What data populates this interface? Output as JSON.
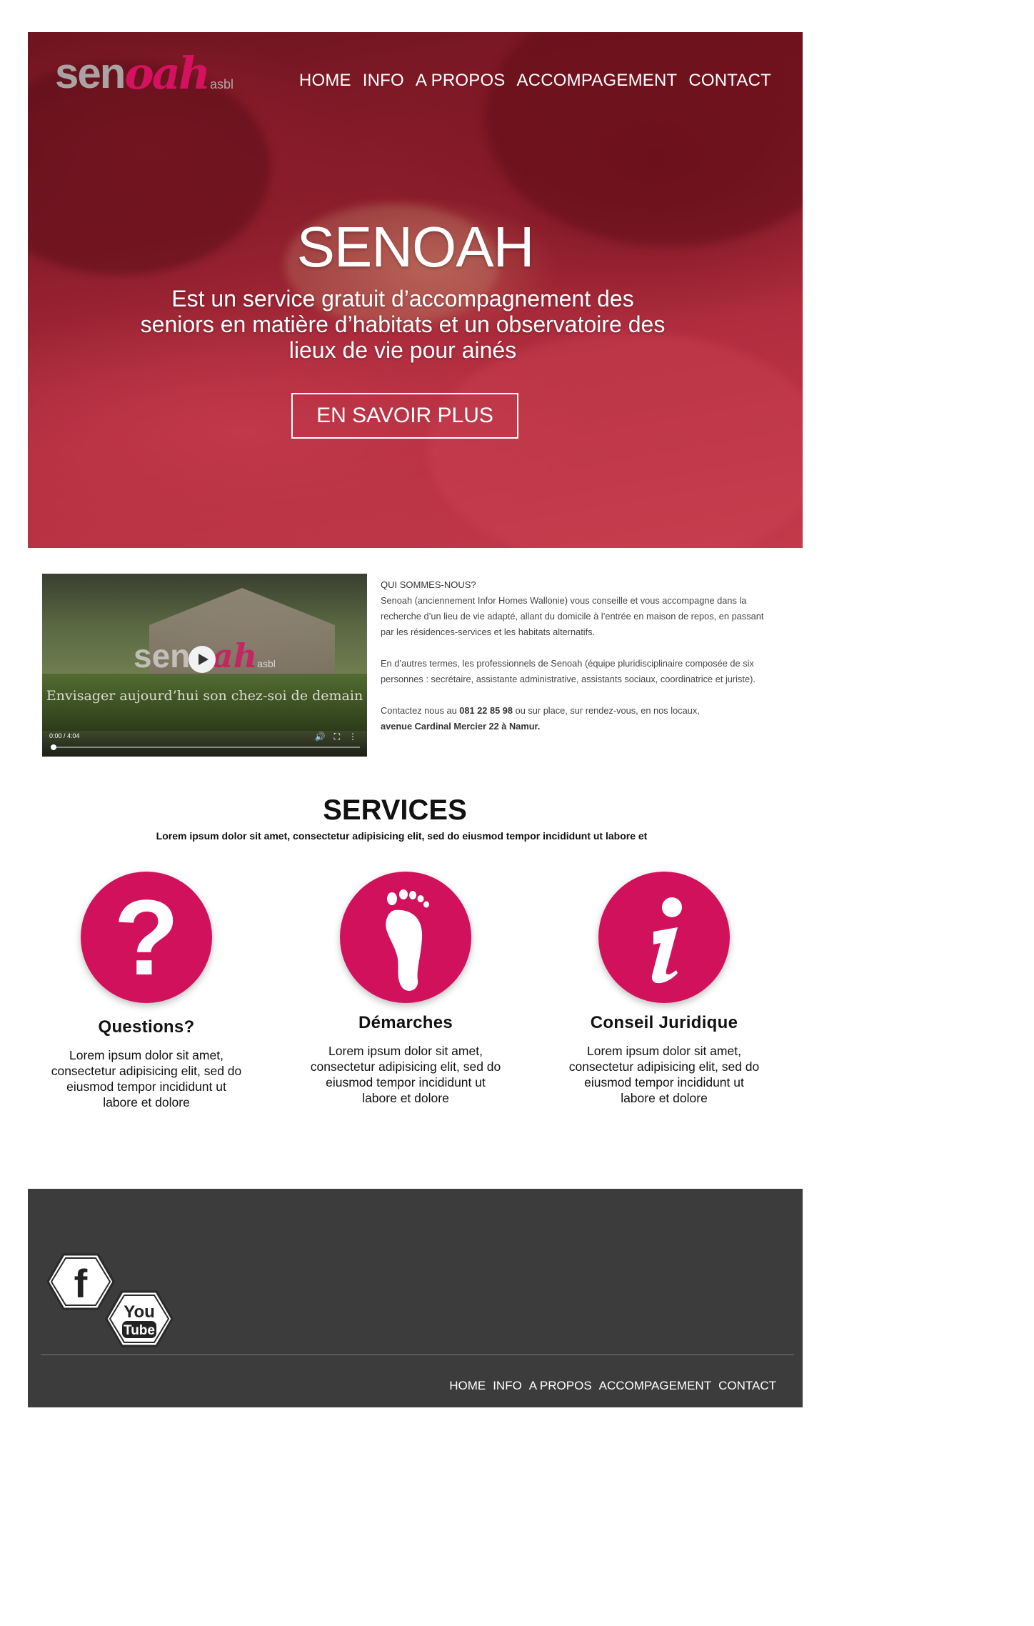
{
  "brand": {
    "logo_main": "sen",
    "logo_accent": "oah",
    "logo_suffix": "asbl"
  },
  "nav": [
    "HOME",
    "INFO",
    "A PROPOS",
    "ACCOMPAGEMENT",
    "CONTACT"
  ],
  "hero": {
    "title": "SENOAH",
    "subtitle": "Est un service gratuit d’accompagnement des seniors en matière d’habitats et un observatoire des lieux de vie pour ainés",
    "button": "EN SAVOIR PLUS"
  },
  "video": {
    "caption": "Envisager aujourd’hui son chez-soi de demain",
    "time": "0:00 / 4:04",
    "progress": 0
  },
  "about": {
    "heading": "QUI SOMMES-NOUS?",
    "p1": "Senoah (anciennement Infor Homes Wallonie) vous conseille et vous accompagne dans la recherche d’un lieu de vie adapté, allant du domicile à l’entrée en maison de repos, en passant par les résidences-services et les habitats alternatifs.",
    "p2": "En d’autres termes, les professionnels de Senoah (équipe pluridisciplinaire composée de six personnes : secrétaire, assistante administrative, assistants sociaux, coordinatrice et juriste).",
    "contact_prefix": "Contactez nous au ",
    "phone": "081 22 85 98",
    "contact_middle": " ou sur place, sur rendez-vous, en nos locaux,",
    "address": "avenue Cardinal Mercier 22 à Namur."
  },
  "services": {
    "title": "SERVICES",
    "subtitle": "Lorem ipsum dolor sit amet, consectetur adipisicing elit, sed do eiusmod tempor incididunt ut labore et",
    "items": [
      {
        "icon": "question-icon",
        "title": "Questions?",
        "text": "Lorem ipsum dolor sit amet, consectetur adipisicing elit, sed do eiusmod tempor incididunt ut labore et dolore"
      },
      {
        "icon": "footprint-icon",
        "title": "Démarches",
        "text": "Lorem ipsum dolor sit amet, consectetur adipisicing elit, sed do eiusmod tempor incididunt ut labore et dolore"
      },
      {
        "icon": "info-icon",
        "title": "Conseil Juridique",
        "text": "Lorem ipsum dolor sit amet, consectetur adipisicing elit, sed do eiusmod tempor incididunt ut labore et dolore"
      }
    ]
  },
  "footer": {
    "social": [
      "facebook-icon",
      "youtube-icon"
    ],
    "youtube_text_1": "You",
    "youtube_text_2": "Tube",
    "facebook_letter": "f",
    "nav": [
      "HOME",
      "INFO",
      "A PROPOS",
      "ACCOMPAGEMENT",
      "CONTACT"
    ]
  },
  "colors": {
    "accent": "#d1115c",
    "footer_bg": "#3c3c3c",
    "hero_red": "#a82638"
  }
}
